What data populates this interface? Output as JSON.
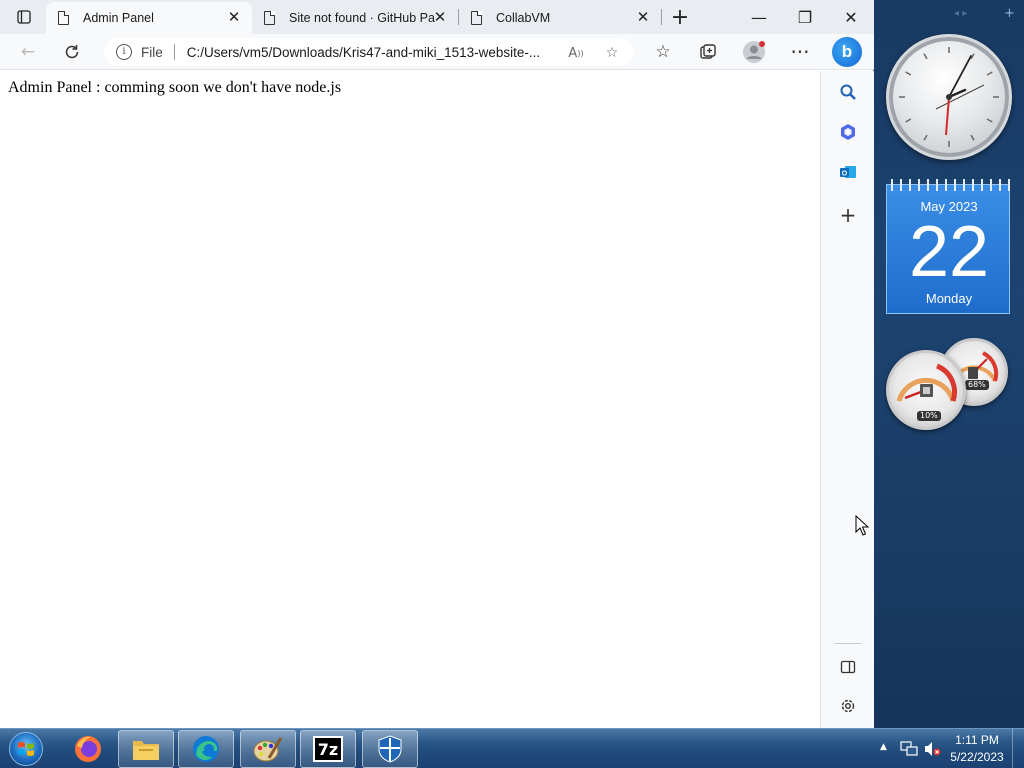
{
  "browser": {
    "tabs": [
      {
        "title": "Admin Panel",
        "active": true
      },
      {
        "title": "Site not found · GitHub Pa",
        "active": false
      },
      {
        "title": "CollabVM",
        "active": false
      }
    ],
    "new_tab_icon": "plus-icon",
    "window_controls": {
      "minimize": "—",
      "restore": "❐",
      "close": "✕"
    },
    "address": {
      "scheme_label": "File",
      "url": "C:/Users/vm5/Downloads/Kris47-and-miki_1513-website-..."
    },
    "page_text": "Admin Panel : comming soon we don't have node.js"
  },
  "sidebar": {
    "items": [
      "search-icon",
      "copilot-icon",
      "outlook-icon",
      "add-icon"
    ],
    "bottom": [
      "split-screen-icon",
      "settings-icon"
    ]
  },
  "gadgets": {
    "calendar": {
      "month_year": "May 2023",
      "day": "22",
      "weekday": "Monday"
    },
    "cpu_meter": {
      "cpu": "10%",
      "memory": "68%"
    },
    "clock": {
      "hour": 1,
      "minute": 11
    }
  },
  "taskbar": {
    "apps": [
      "firefox-icon",
      "file-explorer-icon",
      "edge-icon",
      "paint-icon",
      "7zip-icon",
      "defender-icon"
    ],
    "time": "1:11 PM",
    "date": "5/22/2023"
  },
  "colors": {
    "calendar_blue": "#2a7ed8",
    "taskbar": "#1f4a7a"
  }
}
